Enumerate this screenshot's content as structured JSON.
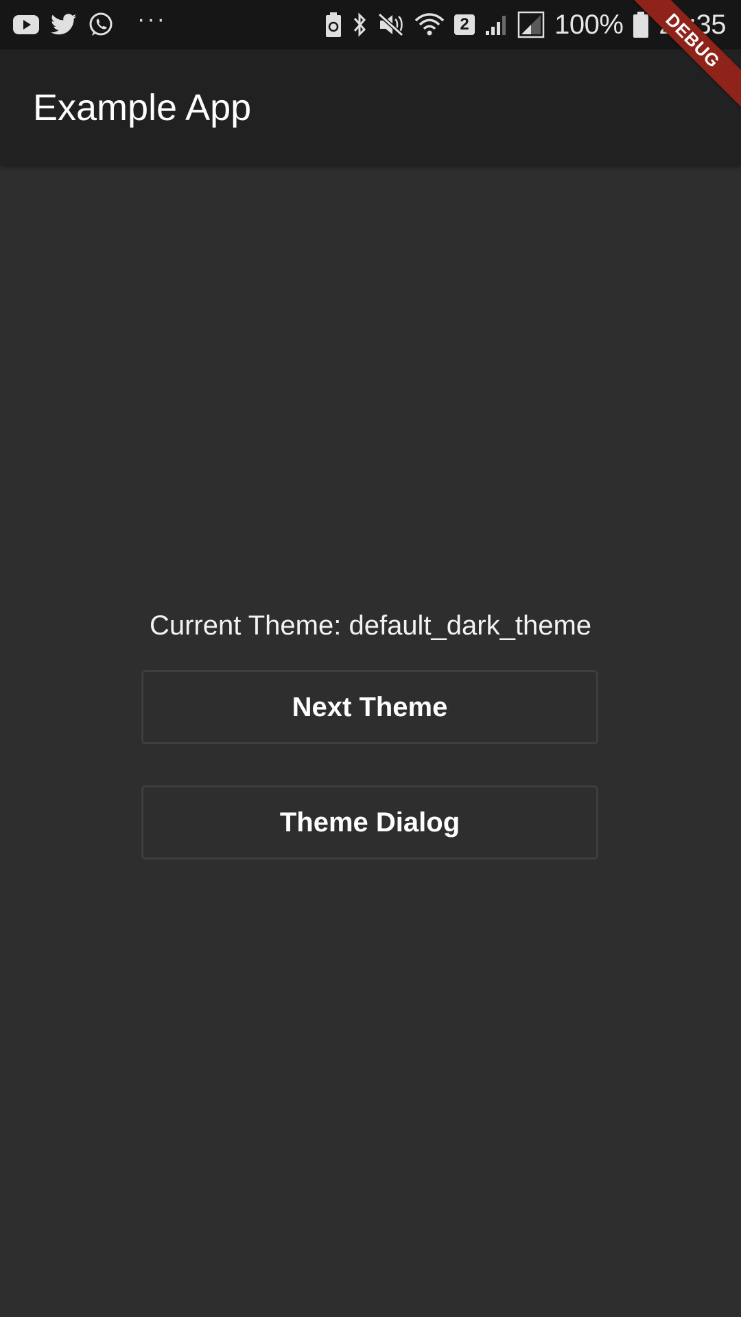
{
  "status_bar": {
    "left_icons": [
      "youtube-icon",
      "twitter-icon",
      "whatsapp-icon"
    ],
    "more": "···",
    "sim_badge": "2",
    "battery_percent": "100%",
    "time": "23:35"
  },
  "app_bar": {
    "title": "Example App"
  },
  "debug_banner": {
    "label": "DEBUG"
  },
  "main": {
    "current_theme_label": "Current Theme: default_dark_theme",
    "next_theme_button": "Next Theme",
    "theme_dialog_button": "Theme Dialog"
  },
  "colors": {
    "background": "#2e2e2e",
    "app_bar": "#212121",
    "status_bar": "#161616",
    "debug_banner": "#8f2219",
    "button_border": "#3e3e3e",
    "text": "#ffffff"
  }
}
